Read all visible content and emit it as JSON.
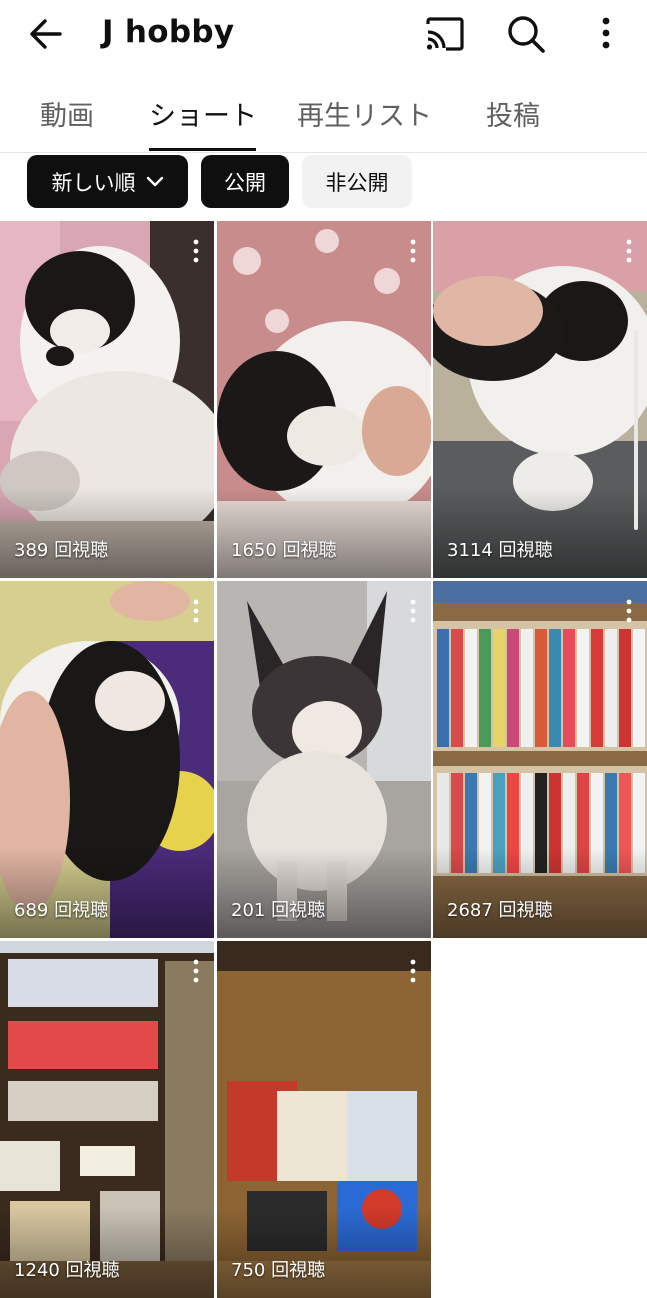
{
  "header": {
    "back_icon": "arrow-left-icon",
    "title": "J hobby",
    "icons": [
      "cast-icon",
      "search-icon",
      "more-vert-icon"
    ]
  },
  "tabs": [
    {
      "label": "動画",
      "active": false
    },
    {
      "label": "ショート",
      "active": true
    },
    {
      "label": "再生リスト",
      "active": false
    },
    {
      "label": "投稿",
      "active": false
    }
  ],
  "filters": {
    "sort": {
      "label": "新しい順",
      "icon": "chevron-down-icon",
      "selected": true
    },
    "public": {
      "label": "公開",
      "selected": true
    },
    "private": {
      "label": "非公開",
      "selected": false
    }
  },
  "shorts": [
    {
      "views": "389 回視聴"
    },
    {
      "views": "1650 回視聴"
    },
    {
      "views": "3114 回視聴"
    },
    {
      "views": "689 回視聴"
    },
    {
      "views": "201 回視聴"
    },
    {
      "views": "2687 回視聴"
    },
    {
      "views": "1240 回視聴"
    },
    {
      "views": "750 回視聴"
    }
  ],
  "colors": {
    "accent": "#0f0f0f",
    "chip_inactive": "#f2f2f2",
    "tab_inactive": "#606060"
  }
}
